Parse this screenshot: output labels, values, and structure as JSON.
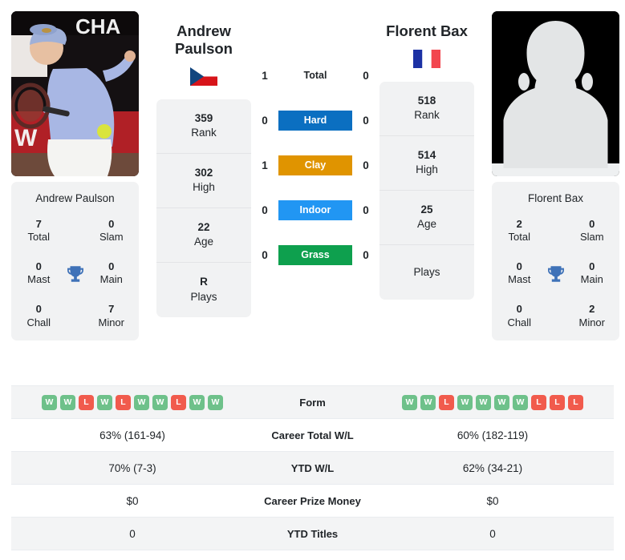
{
  "players": {
    "left": {
      "name_top": "Andrew\nPaulson",
      "name_line1": "Andrew",
      "name_line2": "Paulson",
      "card_name": "Andrew Paulson",
      "flag": "czech-republic-flag",
      "photo": "player-action-photo",
      "rank_stats": [
        {
          "value": "359",
          "label": "Rank"
        },
        {
          "value": "302",
          "label": "High"
        },
        {
          "value": "22",
          "label": "Age"
        },
        {
          "value": "R",
          "label": "Plays"
        }
      ],
      "titles": {
        "total_value": "7",
        "total_label": "Total",
        "slam_value": "0",
        "slam_label": "Slam",
        "mast_value": "0",
        "mast_label": "Mast",
        "main_value": "0",
        "main_label": "Main",
        "chall_value": "0",
        "chall_label": "Chall",
        "minor_value": "7",
        "minor_label": "Minor"
      },
      "form": [
        "W",
        "W",
        "L",
        "W",
        "L",
        "W",
        "W",
        "L",
        "W",
        "W"
      ],
      "career_wl": "63% (161-94)",
      "ytd_wl": "70% (7-3)",
      "prize_money": "$0",
      "ytd_titles": "0"
    },
    "right": {
      "name_line1": "Florent Bax",
      "name_line2": "",
      "card_name": "Florent Bax",
      "flag": "france-flag",
      "photo": "player-placeholder-avatar",
      "rank_stats": [
        {
          "value": "518",
          "label": "Rank"
        },
        {
          "value": "514",
          "label": "High"
        },
        {
          "value": "25",
          "label": "Age"
        },
        {
          "value": "",
          "label": "Plays"
        }
      ],
      "titles": {
        "total_value": "2",
        "total_label": "Total",
        "slam_value": "0",
        "slam_label": "Slam",
        "mast_value": "0",
        "mast_label": "Mast",
        "main_value": "0",
        "main_label": "Main",
        "chall_value": "0",
        "chall_label": "Chall",
        "minor_value": "2",
        "minor_label": "Minor"
      },
      "form": [
        "W",
        "W",
        "L",
        "W",
        "W",
        "W",
        "W",
        "L",
        "L",
        "L"
      ],
      "career_wl": "60% (182-119)",
      "ytd_wl": "62% (34-21)",
      "prize_money": "$0",
      "ytd_titles": "0"
    }
  },
  "h2h": {
    "total": {
      "label": "Total",
      "left": "1",
      "right": "0",
      "type": "plain"
    },
    "surfaces": [
      {
        "label": "Hard",
        "left": "0",
        "right": "0",
        "color": "#0b6fc1"
      },
      {
        "label": "Clay",
        "left": "1",
        "right": "0",
        "color": "#e09400"
      },
      {
        "label": "Indoor",
        "left": "0",
        "right": "0",
        "color": "#2196f3"
      },
      {
        "label": "Grass",
        "left": "0",
        "right": "0",
        "color": "#0ea04e"
      }
    ]
  },
  "table": {
    "rows": [
      {
        "label": "Form",
        "type": "form"
      },
      {
        "label": "Career Total W/L",
        "left": "63% (161-94)",
        "right": "60% (182-119)"
      },
      {
        "label": "YTD W/L",
        "left": "70% (7-3)",
        "right": "62% (34-21)"
      },
      {
        "label": "Career Prize Money",
        "left": "$0",
        "right": "$0"
      },
      {
        "label": "YTD Titles",
        "left": "0",
        "right": "0"
      }
    ]
  },
  "colors": {
    "hard": "#0b6fc1",
    "clay": "#e09400",
    "indoor": "#2196f3",
    "grass": "#0ea04e",
    "win": "#6ec18a",
    "loss": "#f15b4d",
    "trophy": "#3f72b8",
    "card_bg": "#f1f2f3"
  }
}
